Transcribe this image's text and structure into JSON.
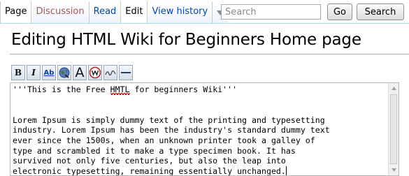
{
  "tabs": [
    {
      "label": "Page"
    },
    {
      "label": "Discussion"
    },
    {
      "label": "Read"
    },
    {
      "label": "Edit"
    },
    {
      "label": "View history"
    }
  ],
  "search": {
    "placeholder": "Search",
    "go_label": "Go",
    "search_label": "Search"
  },
  "page_title": "Editing HTML Wiki for Beginners Home page",
  "toolbar": [
    {
      "name": "bold-button",
      "icon": "bold-icon",
      "glyph": "B"
    },
    {
      "name": "italic-button",
      "icon": "italic-icon",
      "glyph": "I"
    },
    {
      "name": "internal-link-button",
      "icon": "internal-link-icon",
      "glyph": "Ab"
    },
    {
      "name": "external-link-button",
      "icon": "globe-link-icon"
    },
    {
      "name": "headline-button",
      "icon": "headline-icon",
      "glyph": "A"
    },
    {
      "name": "signature-button",
      "icon": "signature-icon"
    },
    {
      "name": "horizontal-line-button",
      "icon": "horizontal-line-icon"
    }
  ],
  "editor": {
    "line1_prefix": "'''This is the Free ",
    "line1_misspelled": "HMTL",
    "line1_suffix": " for beginners Wiki'''",
    "paragraph": "Lorem Ipsum is simply dummy text of the printing and typesetting\nindustry. Lorem Ipsum has been the industry's standard dummy text\never since the 1500s, when an unknown printer took a galley of\ntype and scrambled it to make a type specimen book. It has\nsurvived not only five centuries, but also the leap into\nelectronic typesetting, remaining essentially unchanged."
  },
  "colors": {
    "link": "#0645ad",
    "discussion_tab": "#a55858",
    "tab_border": "#a7d7f9",
    "spell_error": "#dd0000"
  }
}
